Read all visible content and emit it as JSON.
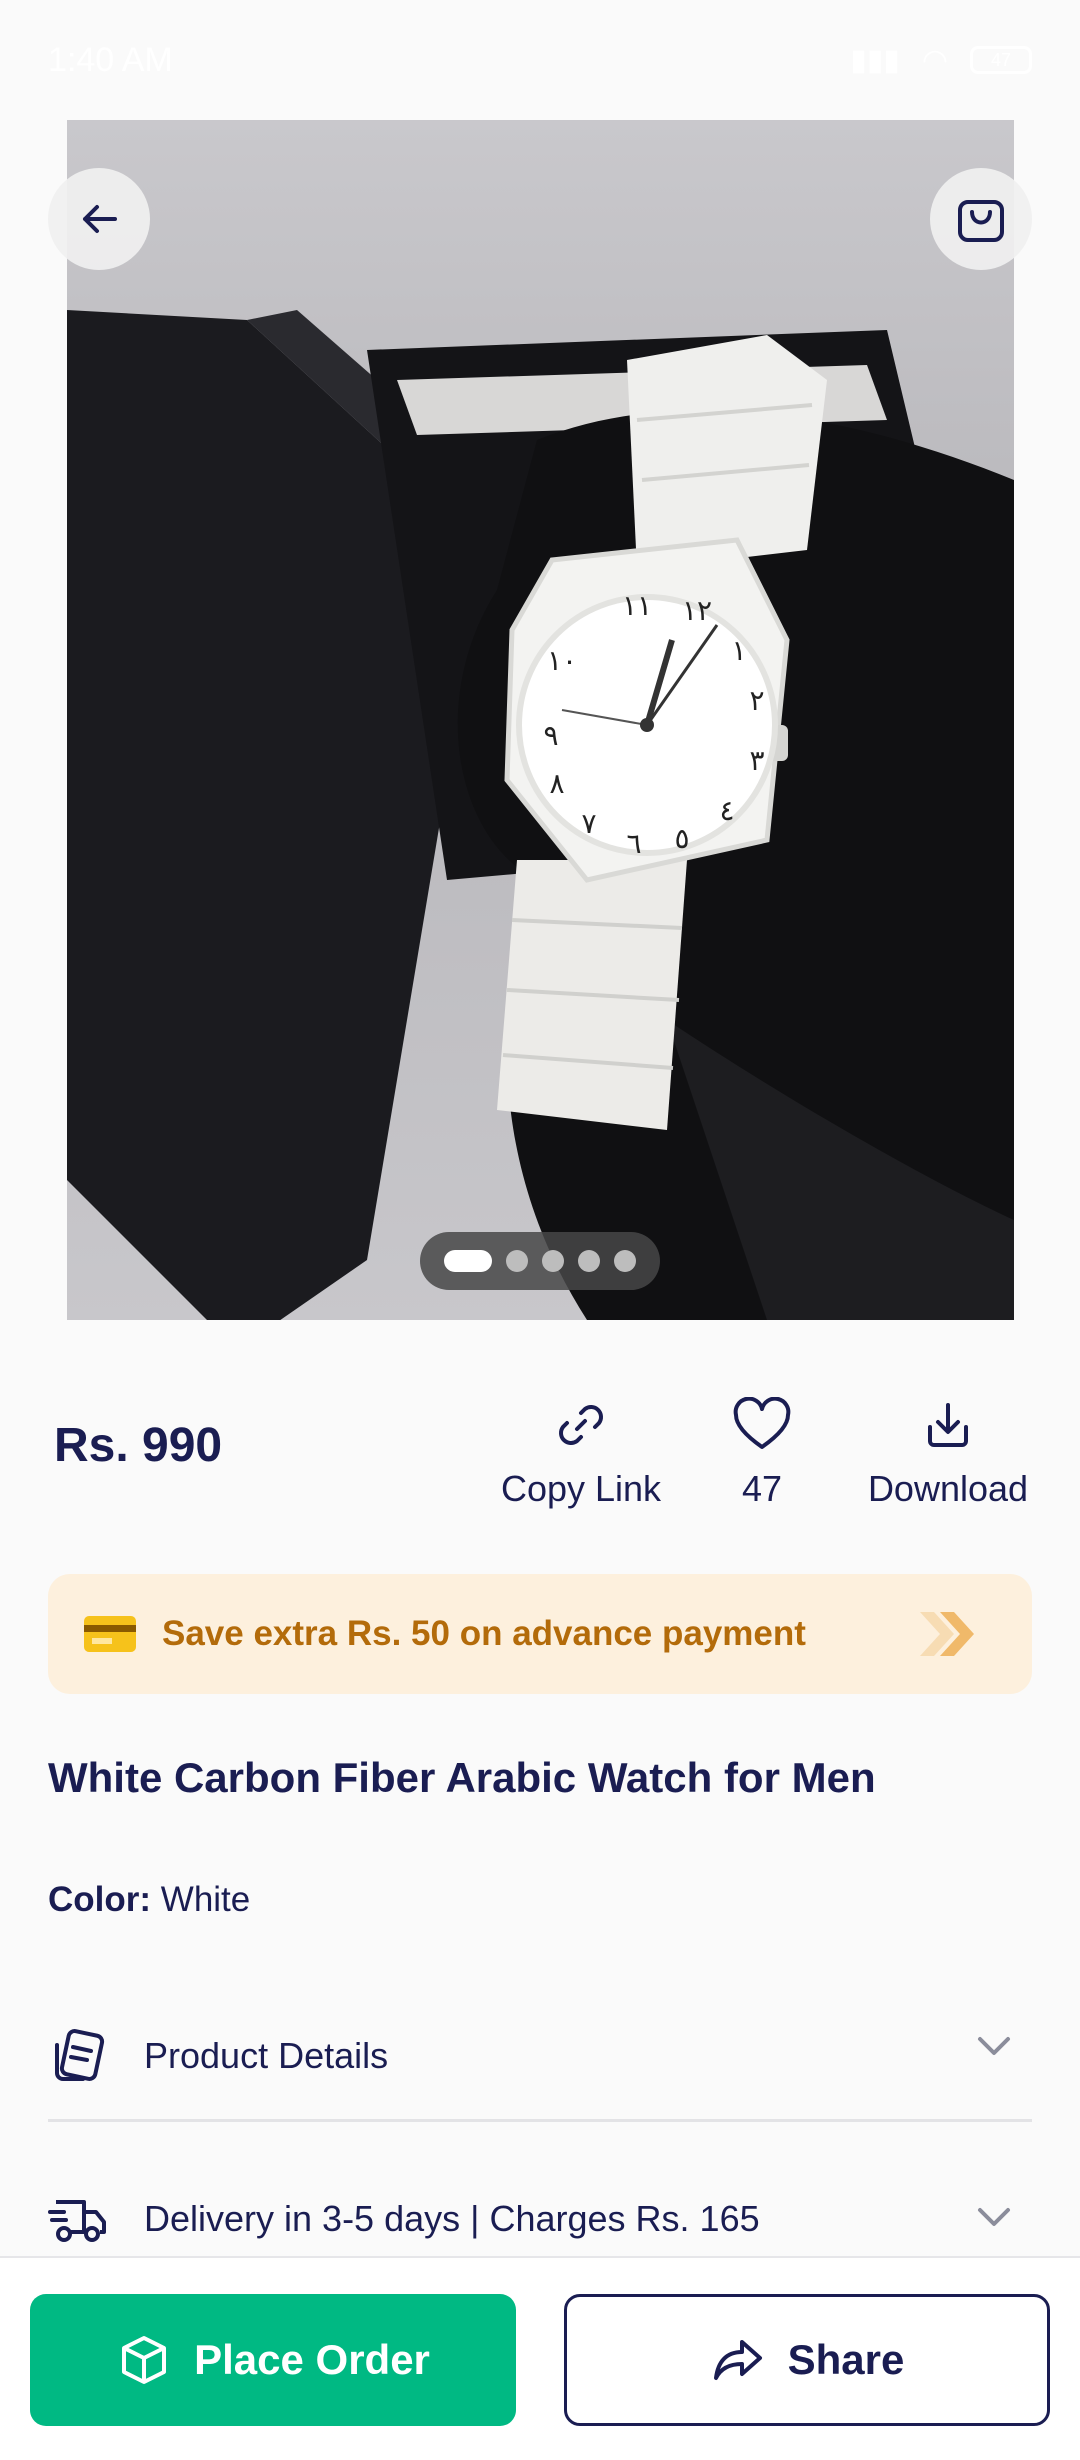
{
  "status_bar": {
    "time": "1:40 AM",
    "battery": "47"
  },
  "product": {
    "price": "Rs. 990",
    "title": "White Carbon Fiber Arabic Watch for Men",
    "color_label": "Color:",
    "color_value": "White"
  },
  "gallery": {
    "image_count": 5,
    "active_index": 0
  },
  "actions": {
    "copy_link": "Copy Link",
    "likes": "47",
    "download": "Download"
  },
  "promo": {
    "text": "Save extra Rs. 50 on advance payment"
  },
  "accordions": {
    "product_details": "Product Details",
    "delivery": "Delivery in 3-5 days | Charges Rs. 165"
  },
  "bottom_bar": {
    "place_order": "Place Order",
    "share": "Share"
  },
  "colors": {
    "primary_text": "#1a1d52",
    "accent_green": "#00b983",
    "promo_bg": "#fdf0dd",
    "promo_text": "#b36b0a"
  },
  "icons": [
    "back-arrow-icon",
    "shopping-bag-icon",
    "link-icon",
    "heart-icon",
    "download-icon",
    "credit-card-icon",
    "double-chevron-right-icon",
    "product-details-icon",
    "delivery-truck-icon",
    "chevron-down-icon",
    "box-icon",
    "share-icon"
  ]
}
